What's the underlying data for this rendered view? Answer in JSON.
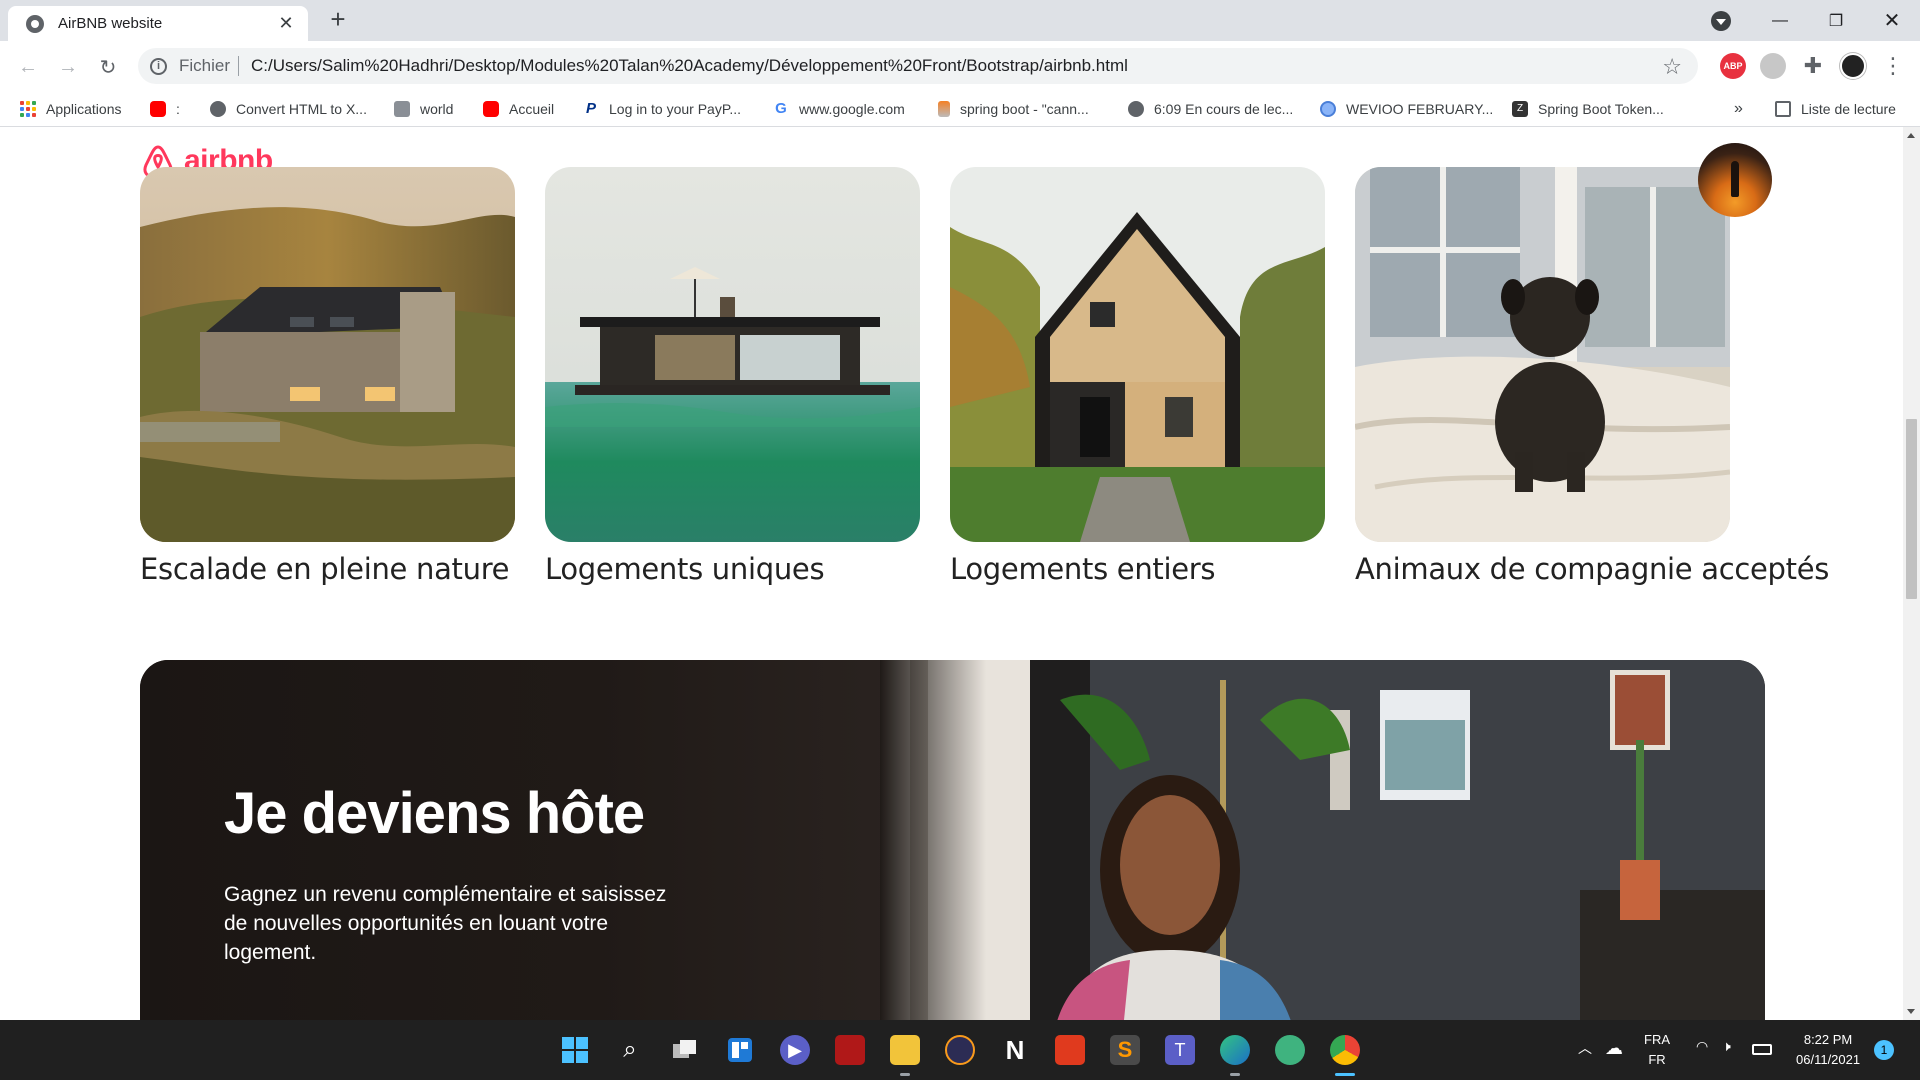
{
  "browser": {
    "tab_title": "AirBNB website",
    "url_scheme": "Fichier",
    "url": "C:/Users/Salim%20Hadhri/Desktop/Modules%20Talan%20Academy/Développement%20Front/Bootstrap/airbnb.html",
    "abp_label": "ABP"
  },
  "bookmarks": {
    "items": [
      {
        "label": "Applications",
        "icon": "apps-grid-icon"
      },
      {
        "label": ":",
        "icon": "youtube-icon"
      },
      {
        "label": "Convert HTML to X...",
        "icon": "globe-icon"
      },
      {
        "label": "world",
        "icon": "map-icon"
      },
      {
        "label": "Accueil",
        "icon": "youtube-icon"
      },
      {
        "label": "Log in to your PayP...",
        "icon": "paypal-icon"
      },
      {
        "label": "www.google.com",
        "icon": "google-icon"
      },
      {
        "label": "spring boot - \"cann...",
        "icon": "stackoverflow-icon"
      },
      {
        "label": "6:09 En cours de lec...",
        "icon": "globe-icon"
      },
      {
        "label": "WEVIOO FEBRUARY...",
        "icon": "globe-blue-icon"
      },
      {
        "label": "Spring Boot Token...",
        "icon": "z-icon"
      }
    ],
    "overflow": "»",
    "reading_list": "Liste de lecture"
  },
  "page": {
    "logo_text": "airbnb",
    "cards": [
      {
        "title": "Escalade en pleine nature"
      },
      {
        "title": "Logements uniques"
      },
      {
        "title": "Logements entiers"
      },
      {
        "title": "Animaux de compagnie acceptés"
      }
    ],
    "host": {
      "title": "Je deviens hôte",
      "description": "Gagnez un revenu complémentaire et saisissez de nouvelles opportunités en louant votre logement."
    }
  },
  "taskbar": {
    "language": "FRA",
    "layout": "FR",
    "time": "8:22 PM",
    "date": "06/11/2021",
    "notifications": "1"
  },
  "colors": {
    "brand": "#ff385c",
    "taskbar": "#202020"
  }
}
